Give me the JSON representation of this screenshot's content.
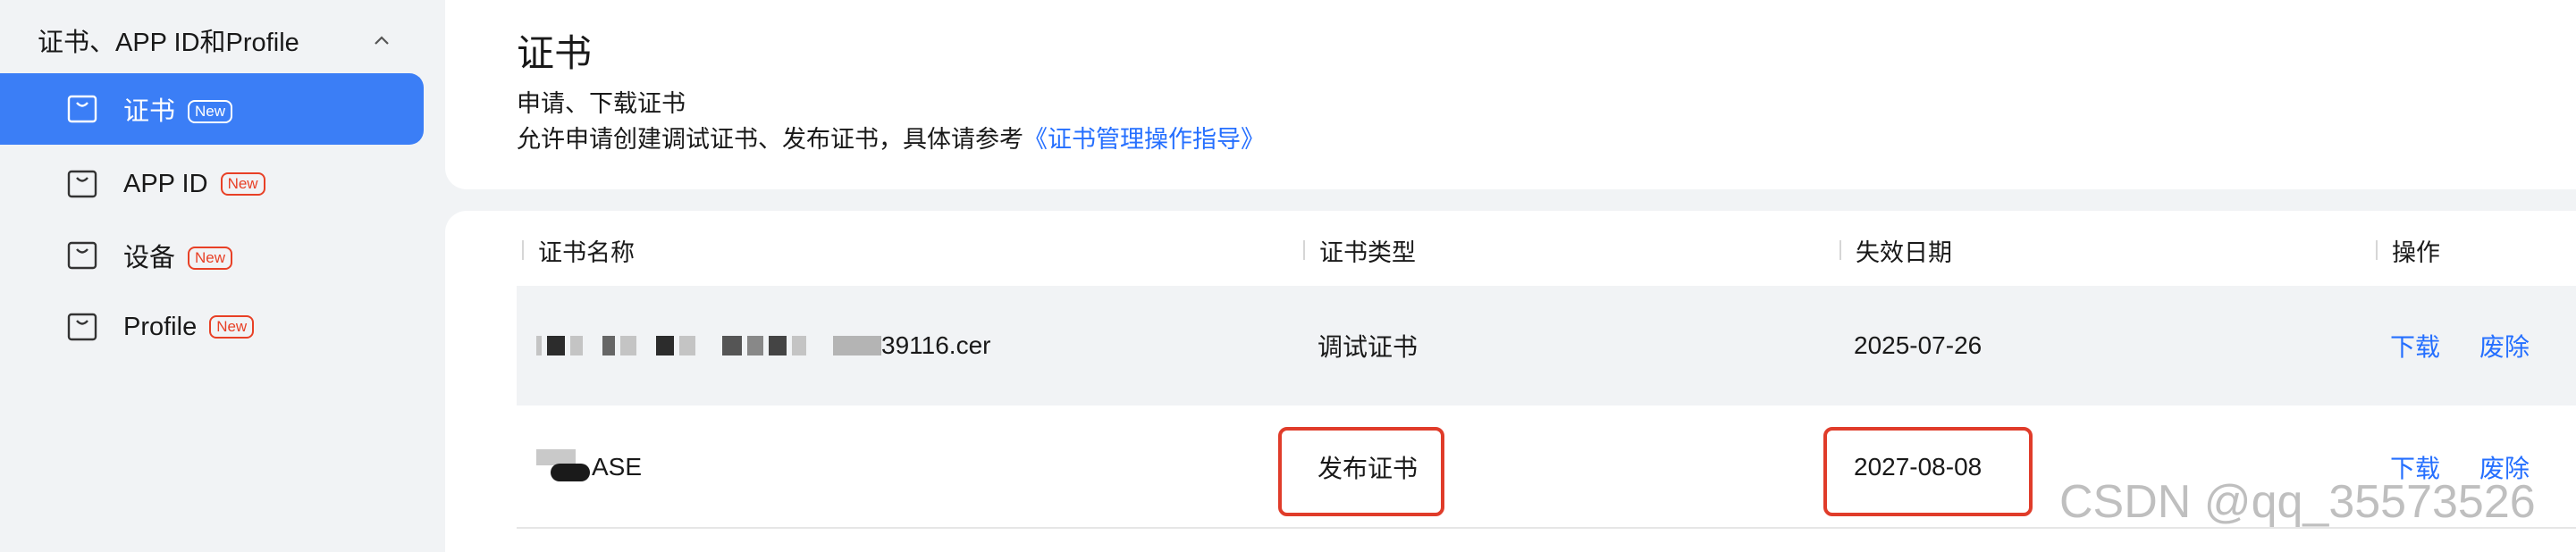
{
  "sidebar": {
    "group_title": "证书、APP ID和Profile",
    "items": [
      {
        "label": "证书",
        "badge": "New",
        "active": true
      },
      {
        "label": "APP ID",
        "badge": "New",
        "active": false
      },
      {
        "label": "设备",
        "badge": "New",
        "active": false
      },
      {
        "label": "Profile",
        "badge": "New",
        "active": false
      }
    ]
  },
  "header": {
    "title": "证书",
    "subtitle": "申请、下载证书",
    "description": "允许申请创建调试证书、发布证书，具体请参考",
    "link": "《证书管理操作指导》"
  },
  "table": {
    "columns": [
      "证书名称",
      "证书类型",
      "失效日期",
      "操作"
    ],
    "rows": [
      {
        "name_visible": "39116.cer",
        "type": "调试证书",
        "expiry": "2025-07-26",
        "download": "下载",
        "revoke": "废除"
      },
      {
        "name_visible": "ASE",
        "type": "发布证书",
        "expiry": "2027-08-08",
        "download": "下载",
        "revoke": "废除"
      }
    ]
  },
  "watermark": "CSDN @qq_35573526",
  "colors": {
    "accent": "#3b7ef6",
    "link": "#256fff",
    "badge": "#e84026",
    "highlight": "#e03c2a"
  }
}
